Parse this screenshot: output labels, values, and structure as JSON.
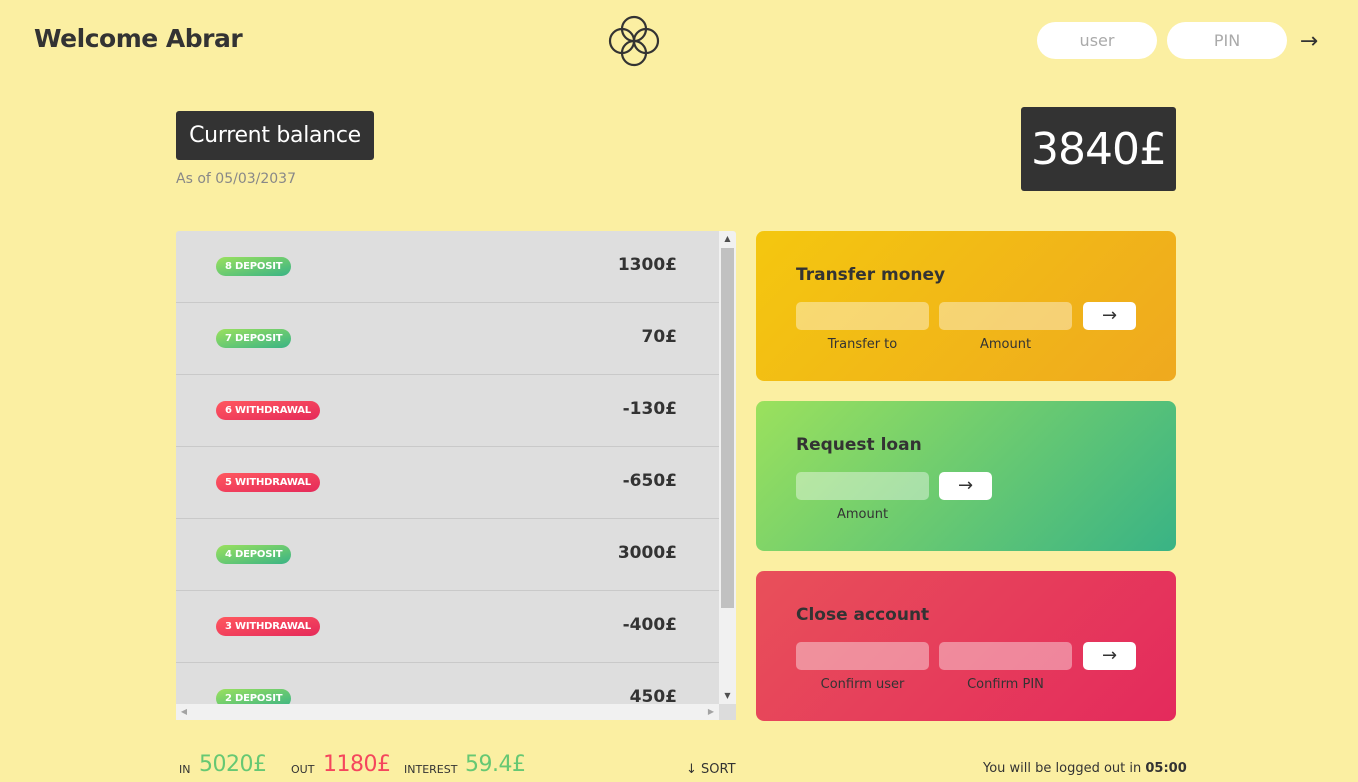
{
  "nav": {
    "welcome": "Welcome Abrar",
    "user_placeholder": "user",
    "pin_placeholder": "PIN",
    "login_arrow": "→"
  },
  "balance": {
    "label": "Current balance",
    "date_prefix": "As of",
    "date": "05/03/2037",
    "value": "3840£"
  },
  "movements": [
    {
      "type_label": "8 DEPOSIT",
      "kind": "deposit",
      "value": "1300£"
    },
    {
      "type_label": "7 DEPOSIT",
      "kind": "deposit",
      "value": "70£"
    },
    {
      "type_label": "6 WITHDRAWAL",
      "kind": "withdrawal",
      "value": "-130£"
    },
    {
      "type_label": "5 WITHDRAWAL",
      "kind": "withdrawal",
      "value": "-650£"
    },
    {
      "type_label": "4 DEPOSIT",
      "kind": "deposit",
      "value": "3000£"
    },
    {
      "type_label": "3 WITHDRAWAL",
      "kind": "withdrawal",
      "value": "-400£"
    },
    {
      "type_label": "2 DEPOSIT",
      "kind": "deposit",
      "value": "450£"
    }
  ],
  "operations": {
    "transfer": {
      "title": "Transfer money",
      "label_to": "Transfer to",
      "label_amount": "Amount",
      "button": "→"
    },
    "loan": {
      "title": "Request loan",
      "label_amount": "Amount",
      "button": "→"
    },
    "close": {
      "title": "Close account",
      "label_user": "Confirm user",
      "label_pin": "Confirm PIN",
      "button": "→"
    }
  },
  "summary": {
    "in_label": "In",
    "in_value": "5020£",
    "out_label": "Out",
    "out_value": "1180£",
    "interest_label": "Interest",
    "interest_value": "59.4£",
    "sort_label": "↓ SORT"
  },
  "logout": {
    "text": "You will be logged out in",
    "timer": "05:00"
  },
  "colors": {
    "background": "#fbefa2",
    "dark": "#333333",
    "deposit": "#66c873",
    "withdrawal": "#f5465d"
  }
}
